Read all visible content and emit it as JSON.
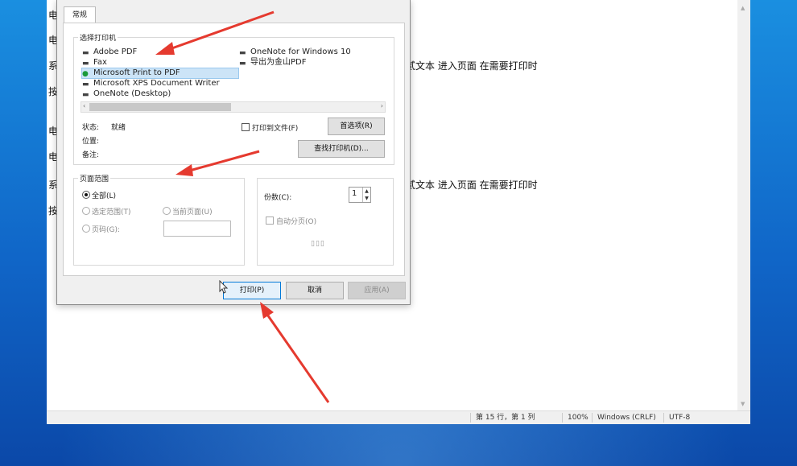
{
  "notepad": {
    "lines": [
      {
        "text": "电"
      },
      {
        "text": "电"
      },
      {
        "text": "系"
      },
      {
        "text": "按"
      },
      {
        "text": "电"
      },
      {
        "text": "电"
      },
      {
        "text": "系"
      },
      {
        "text": "按"
      }
    ],
    "fragment1": "贰文本  进入页面  在需要打印时",
    "fragment2": "贰文本  进入页面  在需要打印时",
    "status": {
      "position": "第 15 行，第 1 列",
      "zoom": "100%",
      "line_ending": "Windows (CRLF)",
      "encoding": "UTF-8"
    }
  },
  "dialog": {
    "tab": "常规",
    "select_printer_title": "选择打印机",
    "printers_left": [
      "Adobe PDF",
      "Fax",
      "Microsoft Print to PDF",
      "Microsoft XPS Document Writer",
      "OneNote (Desktop)"
    ],
    "printers_right": [
      "OneNote for Windows 10",
      "导出为金山PDF"
    ],
    "selected_printer": "Microsoft Print to PDF",
    "status_label": "状态:",
    "status_value": "就绪",
    "location_label": "位置:",
    "comment_label": "备注:",
    "print_to_file": "打印到文件(F)",
    "preferences_button": "首选项(R)",
    "find_printer_button": "查找打印机(D)...",
    "page_range_title": "页面范围",
    "range_all": "全部(L)",
    "range_selection": "选定范围(T)",
    "range_current": "当前页面(U)",
    "range_pages": "页码(G):",
    "copies_label": "份数(C):",
    "copies_value": "1",
    "collate": "自动分页(O)",
    "print_button": "打印(P)",
    "cancel_button": "取消",
    "apply_button": "应用(A)"
  },
  "colors": {
    "arrow": "#e53a2f",
    "accent": "#0078d7"
  }
}
